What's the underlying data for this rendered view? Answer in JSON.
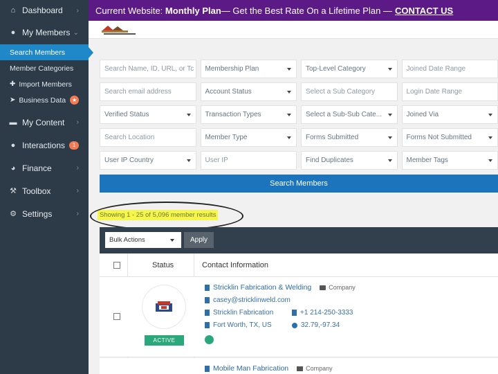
{
  "sidebar": {
    "dashboard": "Dashboard",
    "my_members": "My Members",
    "sub": {
      "search_members": "Search Members",
      "member_categories": "Member Categories",
      "import_members": "Import Members",
      "business_data": "Business Data",
      "business_data_badge": "★"
    },
    "my_content": "My Content",
    "interactions": "Interactions",
    "interactions_badge": "1",
    "finance": "Finance",
    "toolbox": "Toolbox",
    "settings": "Settings"
  },
  "banner": {
    "label": "Current Website:",
    "plan": "Monthly Plan",
    "text": " — Get the Best Rate On a Lifetime Plan —",
    "contact": "CONTACT US"
  },
  "filters": {
    "rows": [
      [
        "Search Name, ID, URL, or Tc",
        "Membership Plan",
        "Top-Level Category",
        "Joined Date Range"
      ],
      [
        "Search email address",
        "Account Status",
        "Select a Sub Category",
        "Login Date Range"
      ],
      [
        "Verified Status",
        "Transaction Types",
        "Select a Sub-Sub Cate...",
        "Joined Via"
      ],
      [
        "Search Location",
        "Member Type",
        "Forms Submitted",
        "Forms Not Submitted"
      ],
      [
        "User IP Country",
        "User IP",
        "Find Duplicates",
        "Member Tags"
      ]
    ]
  },
  "search_button": "Search Members",
  "results_text": "Showing 1 - 25 of 5,096 member results",
  "table": {
    "bulk_actions": "Bulk Actions",
    "apply": "Apply",
    "col_status": "Status",
    "col_contact": "Contact Information",
    "rows": [
      {
        "name": "Stricklin Fabrication & Welding",
        "type": "Company",
        "email": "casey@stricklinweld.com",
        "company": "Stricklin Fabrication",
        "phone": "+1 214-250-3333",
        "location": "Fort Worth, TX, US",
        "geo": "32.79,-97.34",
        "status": "ACTIVE"
      },
      {
        "name": "Mobile Man Fabrication",
        "type": "Company"
      }
    ]
  }
}
